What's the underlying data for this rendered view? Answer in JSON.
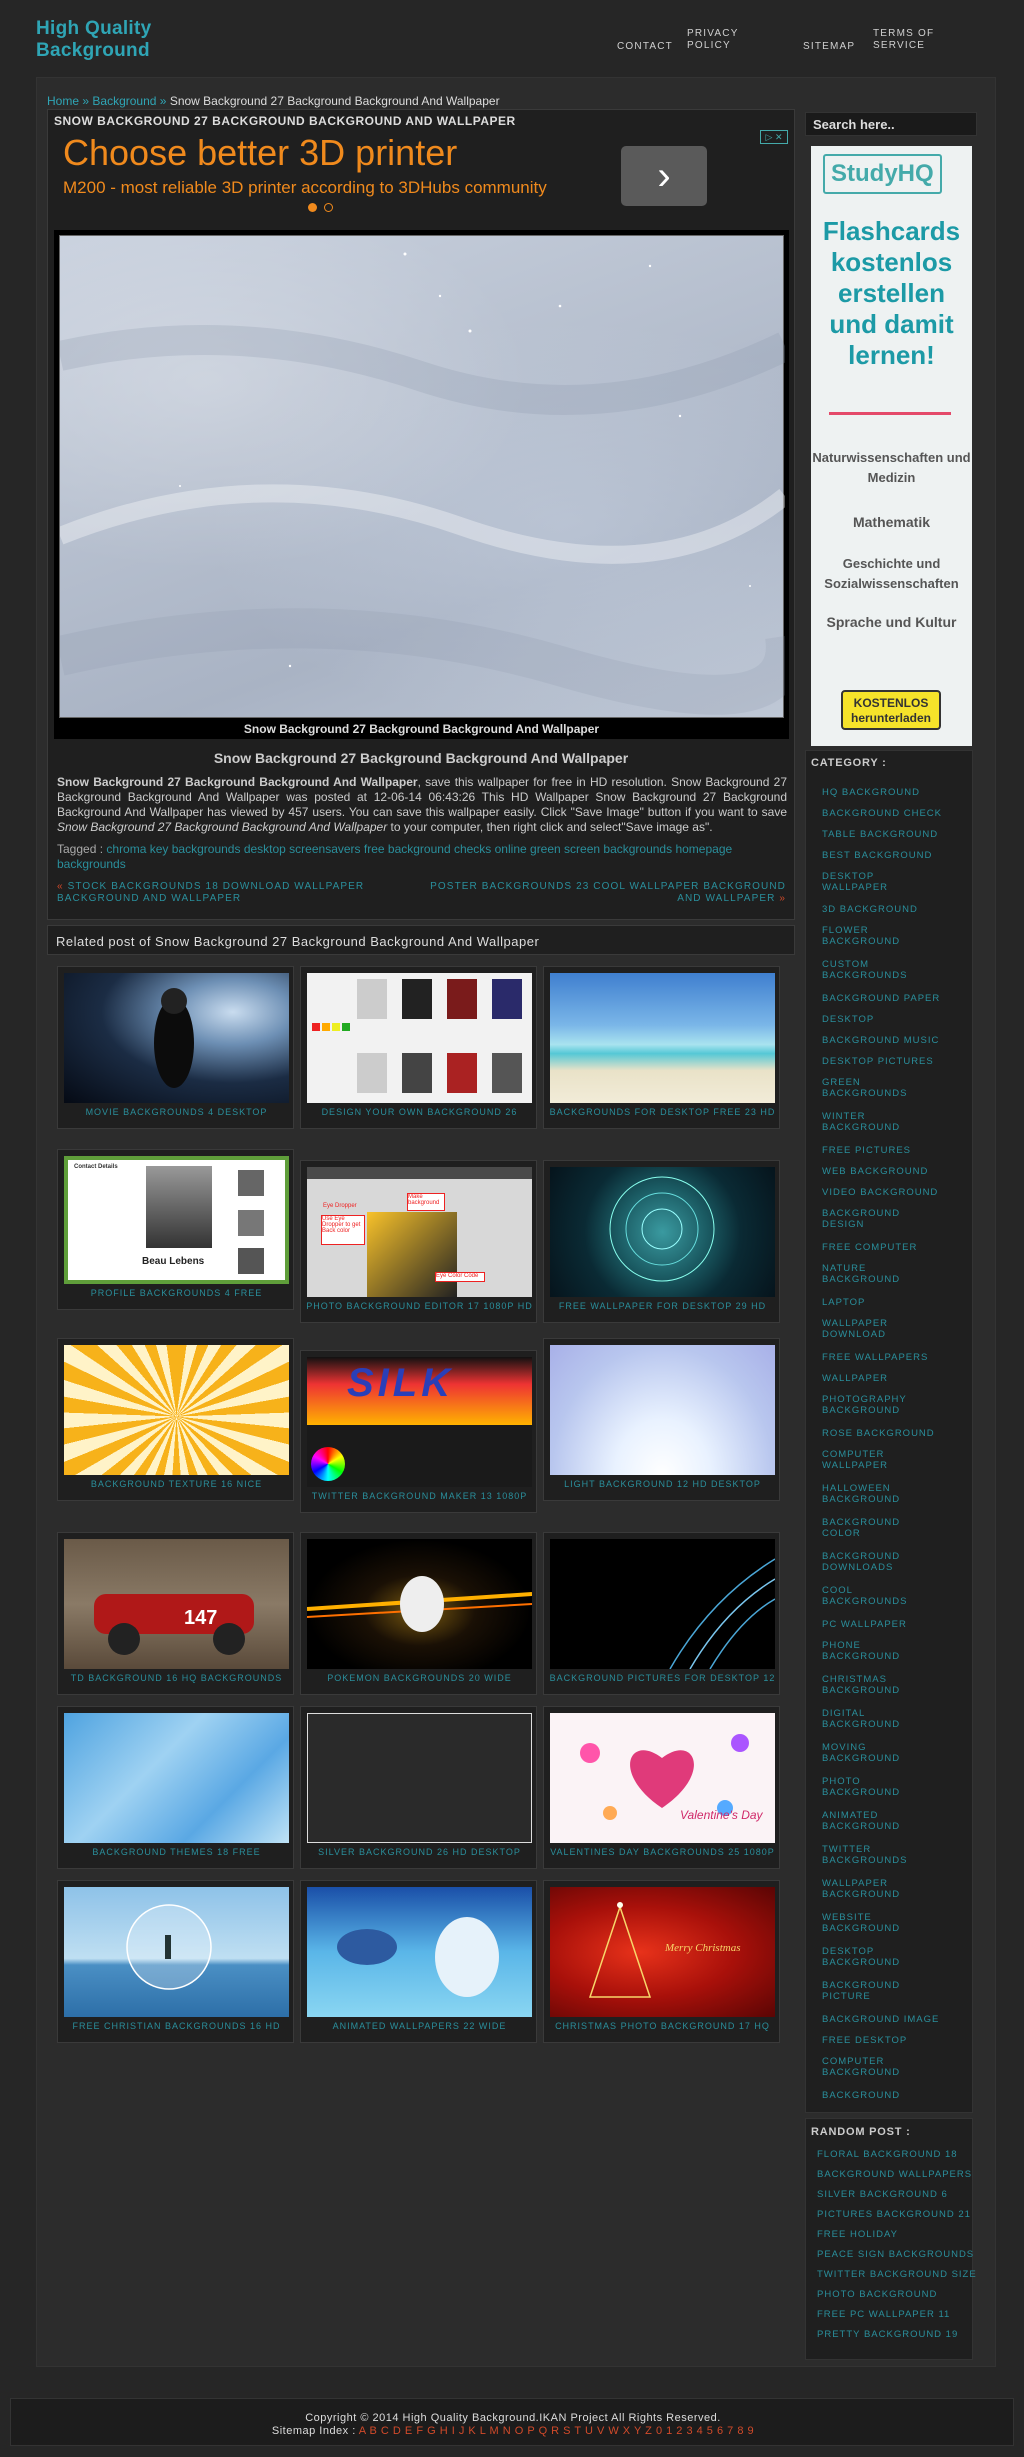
{
  "site": {
    "title_line1": "High Quality",
    "title_line2": "Background"
  },
  "nav": [
    {
      "label": "CONTACT"
    },
    {
      "label": "PRIVACY POLICY"
    },
    {
      "label": "SITEMAP"
    },
    {
      "label": "TERMS OF SERVICE"
    }
  ],
  "breadcrumb": {
    "home": "Home",
    "sep": "»",
    "category": "Background",
    "current": "Snow Background 27 Background Background And Wallpaper"
  },
  "post": {
    "title": "SNOW BACKGROUND 27 BACKGROUND BACKGROUND AND WALLPAPER",
    "image_caption": "Snow Background 27 Background Background And Wallpaper",
    "subtitle": "Snow Background 27 Background Background And Wallpaper",
    "desc_bold": "Snow Background 27 Background Background And Wallpaper",
    "desc_text": ", save this wallpaper for free in HD resolution. Snow Background 27 Background Background And Wallpaper was posted at 12-06-14 06:43:26 This HD Wallpaper Snow Background 27 Background Background And Wallpaper has viewed by 457 users. You can save this wallpaper easily. Click \"Save Image\" button if you want to save ",
    "desc_italic": "Snow Background 27 Background Background And Wallpaper",
    "desc_end": " to your computer, then right click and select\"Save image as\".",
    "tags_label": "Tagged :",
    "tags": [
      "chroma key backgrounds",
      "desktop screensavers free",
      "background checks online",
      "green screen backgrounds",
      "homepage backgrounds"
    ],
    "prev_arrow": "«",
    "prev": "STOCK BACKGROUNDS 18 DOWNLOAD WALLPAPER BACKGROUND AND WALLPAPER",
    "next": "POSTER BACKGROUNDS 23 COOL WALLPAPER BACKGROUND AND WALLPAPER",
    "next_arrow": "»"
  },
  "ad": {
    "headline": "Choose better 3D printer",
    "sub": "M200 - most reliable 3D printer according to 3DHubs community",
    "arrow": "›",
    "close": "▷ ✕"
  },
  "related": {
    "title": "Related post of Snow Background 27 Background Background And Wallpaper",
    "items": [
      {
        "label": "MOVIE BACKGROUNDS 4 DESKTOP"
      },
      {
        "label": "DESIGN YOUR OWN BACKGROUND 26"
      },
      {
        "label": "BACKGROUNDS FOR DESKTOP FREE 23 HD"
      },
      {
        "label": "PROFILE BACKGROUNDS 4 FREE"
      },
      {
        "label": "PHOTO BACKGROUND EDITOR 17 1080P HD"
      },
      {
        "label": "FREE WALLPAPER FOR DESKTOP 29 HD"
      },
      {
        "label": "BACKGROUND TEXTURE 16 NICE"
      },
      {
        "label": "TWITTER BACKGROUND MAKER 13 1080P"
      },
      {
        "label": "LIGHT BACKGROUND 12 HD DESKTOP"
      },
      {
        "label": "TD BACKGROUND 16 HQ BACKGROUNDS"
      },
      {
        "label": "POKEMON BACKGROUNDS 20 WIDE"
      },
      {
        "label": "BACKGROUND PICTURES FOR DESKTOP 12"
      },
      {
        "label": "BACKGROUND THEMES 18 FREE"
      },
      {
        "label": "SILVER BACKGROUND 26 HD DESKTOP"
      },
      {
        "label": "VALENTINES DAY BACKGROUNDS 25 1080P"
      },
      {
        "label": "FREE CHRISTIAN BACKGROUNDS 16 HD"
      },
      {
        "label": "ANIMATED WALLPAPERS 22 WIDE"
      },
      {
        "label": "CHRISTMAS PHOTO BACKGROUND 17 HQ"
      }
    ],
    "thumb_texts": {
      "profile_name": "Beau Lebens",
      "profile_heading": "Contact Details",
      "editor_tip1": "Use Eye Dropper to get Back color",
      "editor_tip2": "Make background",
      "editor_tip3": "Eye Color Code",
      "editor_tip4": "Eye Dropper",
      "graffiti": "SILK",
      "valentine": "Valentine's Day",
      "christmas": "Merry Christmas",
      "td_number": "147"
    }
  },
  "sidebar": {
    "search_placeholder": "Search here..",
    "ad": {
      "logo": "StudyHQ",
      "headline": "Flashcards kostenlos erstellen und damit lernen!",
      "items": [
        "Naturwissenschaften und Medizin",
        "Mathematik",
        "Geschichte und Sozialwissenschaften",
        "Sprache und Kultur"
      ],
      "button": "KOSTENLOS herunterladen"
    },
    "category_title": "CATEGORY :",
    "categories": [
      "HQ BACKGROUND",
      "BACKGROUND CHECK",
      "TABLE BACKGROUND",
      "BEST BACKGROUND",
      "DESKTOP WALLPAPER",
      "3D BACKGROUND",
      "FLOWER BACKGROUND",
      "CUSTOM BACKGROUNDS",
      "BACKGROUND PAPER",
      "DESKTOP",
      "BACKGROUND MUSIC",
      "DESKTOP PICTURES",
      "GREEN BACKGROUNDS",
      "WINTER BACKGROUND",
      "FREE PICTURES",
      "WEB BACKGROUND",
      "VIDEO BACKGROUND",
      "BACKGROUND DESIGN",
      "FREE COMPUTER",
      "NATURE BACKGROUND",
      "LAPTOP",
      "WALLPAPER DOWNLOAD",
      "FREE WALLPAPERS",
      "WALLPAPER",
      "PHOTOGRAPHY BACKGROUND",
      "ROSE BACKGROUND",
      "COMPUTER WALLPAPER",
      "HALLOWEEN BACKGROUND",
      "BACKGROUND COLOR",
      "BACKGROUND DOWNLOADS",
      "COOL BACKGROUNDS",
      "PC WALLPAPER",
      "PHONE BACKGROUND",
      "CHRISTMAS BACKGROUND",
      "DIGITAL BACKGROUND",
      "MOVING BACKGROUND",
      "PHOTO BACKGROUND",
      "ANIMATED BACKGROUND",
      "TWITTER BACKGROUNDS",
      "WALLPAPER BACKGROUND",
      "WEBSITE BACKGROUND",
      "DESKTOP BACKGROUND",
      "BACKGROUND PICTURE",
      "BACKGROUND IMAGE",
      "FREE DESKTOP",
      "COMPUTER BACKGROUND",
      "BACKGROUND"
    ],
    "random_title": "RANDOM POST :",
    "random": [
      "FLORAL BACKGROUND 18",
      "BACKGROUND WALLPAPERS",
      "SILVER BACKGROUND 6",
      "PICTURES BACKGROUND 21",
      "FREE HOLIDAY",
      "PEACE SIGN BACKGROUNDS",
      "TWITTER BACKGROUND SIZE",
      "PHOTO BACKGROUND",
      "FREE PC WALLPAPER 11",
      "PRETTY BACKGROUND 19"
    ]
  },
  "footer": {
    "copyright": "Copyright © 2014 High Quality Background.IKAN Project All Rights Reserved.",
    "index_label": "Sitemap Index :",
    "index_letters": "A B C D E F G H I J K L M N O P Q R S T U V W X Y Z 0 1 2 3 4 5 6 7 8 9"
  }
}
